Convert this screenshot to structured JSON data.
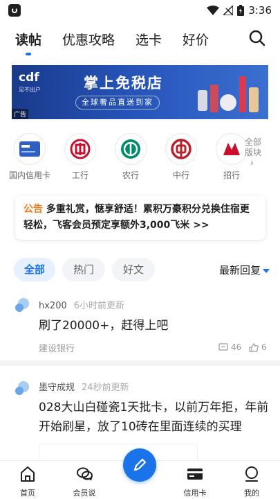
{
  "status_bar": {
    "time": "3:36"
  },
  "top_tabs": [
    {
      "label": "读帖",
      "active": true
    },
    {
      "label": "优惠攻略"
    },
    {
      "label": "选卡"
    },
    {
      "label": "好价"
    }
  ],
  "banner": {
    "brand": "cdf",
    "brand_sub": "足不出户",
    "title": "掌上免税店",
    "subtitle": "全球奢品直送到家",
    "ad_label": "广告"
  },
  "banks": [
    {
      "label": "国内信用卡",
      "icon": "card-icon"
    },
    {
      "label": "工行",
      "icon": "icbc-icon"
    },
    {
      "label": "农行",
      "icon": "abc-icon"
    },
    {
      "label": "中行",
      "icon": "boc-icon"
    },
    {
      "label": "招行",
      "icon": "cmb-icon"
    }
  ],
  "more_banks": {
    "line1": "全部",
    "line2": "版块"
  },
  "notice": {
    "tag": "公告",
    "text": "多重礼赏，惬享舒适！累积万豪积分兑换住宿更轻松，飞客会员预定享额外3,000飞米 >>"
  },
  "filters": [
    {
      "label": "全部",
      "active": true
    },
    {
      "label": "热门"
    },
    {
      "label": "好文"
    }
  ],
  "sort": {
    "label": "最新回复"
  },
  "posts": [
    {
      "author": "hx200",
      "time": "6小时前更新",
      "content": "刷了20000+，赶得上吧",
      "forum": "建设银行",
      "comments": "46",
      "likes": "6"
    },
    {
      "author": "墨守成规",
      "time": "24秒前更新",
      "content": "028大山白碰瓷1天批卡，以前万年拒，年前开始刷星，放了10砖在里面连续的买理"
    }
  ],
  "bottom_nav": [
    {
      "label": "首页",
      "icon": "home-icon"
    },
    {
      "label": "会员说",
      "icon": "chat-icon"
    },
    {
      "label": "",
      "icon": "pen-icon"
    },
    {
      "label": "信用卡",
      "icon": "credit-card-icon"
    },
    {
      "label": "我的",
      "icon": "profile-icon"
    }
  ],
  "colors": {
    "accent": "#1a73e8",
    "notice_tag": "#f07b18"
  }
}
